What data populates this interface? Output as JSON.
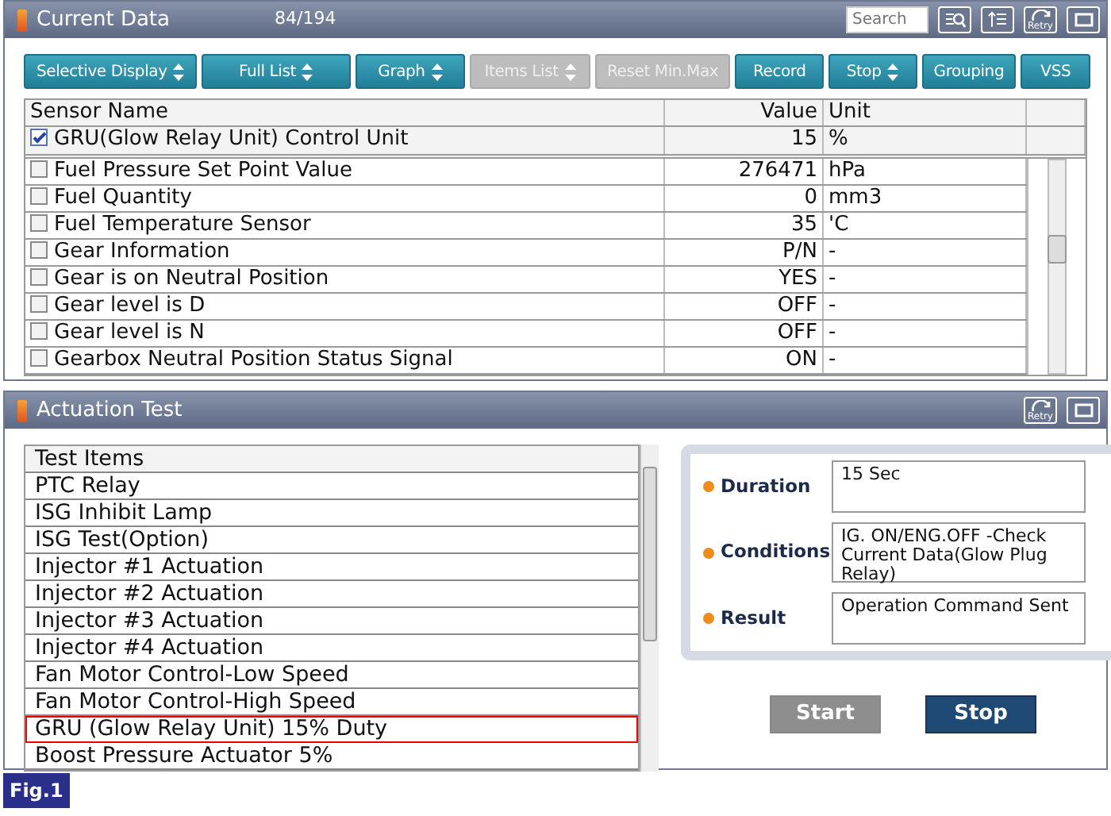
{
  "current_data": {
    "title": "Current Data",
    "count": "84/194",
    "search": {
      "placeholder": "Search"
    },
    "retry_label": "Retry",
    "toolbar": [
      {
        "label": "Selective Display",
        "dropdown": true,
        "disabled": false
      },
      {
        "label": "Full List",
        "dropdown": true,
        "disabled": false
      },
      {
        "label": "Graph",
        "dropdown": true,
        "disabled": false
      },
      {
        "label": "Items List",
        "dropdown": true,
        "disabled": true
      },
      {
        "label": "Reset Min.Max",
        "dropdown": false,
        "disabled": true
      },
      {
        "label": "Record",
        "dropdown": false,
        "disabled": false
      },
      {
        "label": "Stop",
        "dropdown": true,
        "disabled": false
      },
      {
        "label": "Grouping",
        "dropdown": false,
        "disabled": false
      },
      {
        "label": "VSS",
        "dropdown": false,
        "disabled": false
      }
    ],
    "table": {
      "columns": [
        "Sensor Name",
        "Value",
        "Unit"
      ],
      "pinned_rows": [
        {
          "name": "GRU(Glow Relay Unit) Control Unit",
          "value": "15",
          "unit": "%",
          "checked": true
        }
      ],
      "rows": [
        {
          "name": "Fuel Pressure Set Point Value",
          "value": "276471",
          "unit": "hPa",
          "checked": false
        },
        {
          "name": "Fuel Quantity",
          "value": "0",
          "unit": "mm3",
          "checked": false
        },
        {
          "name": "Fuel Temperature Sensor",
          "value": "35",
          "unit": "'C",
          "checked": false
        },
        {
          "name": "Gear Information",
          "value": "P/N",
          "unit": "-",
          "checked": false
        },
        {
          "name": "Gear is on Neutral Position",
          "value": "YES",
          "unit": "-",
          "checked": false
        },
        {
          "name": "Gear level is D",
          "value": "OFF",
          "unit": "-",
          "checked": false
        },
        {
          "name": "Gear level is N",
          "value": "OFF",
          "unit": "-",
          "checked": false
        },
        {
          "name": "Gearbox Neutral Position Status Signal",
          "value": "ON",
          "unit": "-",
          "checked": false
        }
      ]
    }
  },
  "actuation_test": {
    "title": "Actuation Test",
    "retry_label": "Retry",
    "list_header": "Test Items",
    "items": [
      {
        "label": "PTC Relay",
        "selected": false
      },
      {
        "label": "ISG Inhibit Lamp",
        "selected": false
      },
      {
        "label": "ISG Test(Option)",
        "selected": false
      },
      {
        "label": "Injector #1 Actuation",
        "selected": false
      },
      {
        "label": "Injector #2 Actuation",
        "selected": false
      },
      {
        "label": "Injector #3 Actuation",
        "selected": false
      },
      {
        "label": "Injector #4 Actuation",
        "selected": false
      },
      {
        "label": "Fan Motor Control-Low Speed",
        "selected": false
      },
      {
        "label": "Fan Motor Control-High Speed",
        "selected": false
      },
      {
        "label": "GRU (Glow Relay Unit) 15% Duty",
        "selected": true
      },
      {
        "label": "Boost Pressure Actuator 5%",
        "selected": false
      }
    ],
    "details": [
      {
        "label": "Duration",
        "value": "15 Sec"
      },
      {
        "label": "Conditions",
        "value": "IG. ON/ENG.OFF -Check Current Data(Glow Plug Relay)"
      },
      {
        "label": "Result",
        "value": "Operation Command Sent"
      }
    ],
    "buttons": [
      {
        "label": "Start",
        "disabled": true
      },
      {
        "label": "Stop",
        "disabled": false
      }
    ]
  },
  "figure_label": "Fig.1"
}
